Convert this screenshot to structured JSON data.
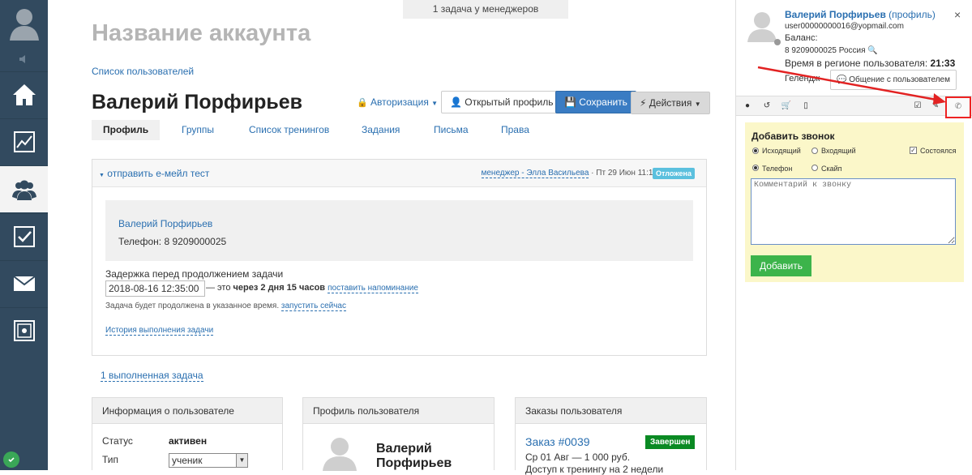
{
  "notice": "1 задача у менеджеров",
  "account_title": "Название аккаунта",
  "users_list_link": "Список пользователей",
  "user_name": "Валерий Порфирьев",
  "buttons": {
    "auth": "Авторизация",
    "open_profile": "Открытый профиль",
    "save": "Сохранить",
    "actions": "Действия"
  },
  "tabs": [
    "Профиль",
    "Группы",
    "Список тренингов",
    "Задания",
    "Письма",
    "Права"
  ],
  "task": {
    "title": "отправить е-мейл тест",
    "manager": "менеджер - Элла Васильева",
    "date": "· Пт 29 Июн 11:17",
    "status": "Отложена",
    "card_name": "Валерий Порфирьев",
    "card_phone": "Телефон: 8 9209000025",
    "delay_label": "Задержка перед продолжением задачи",
    "delay_value": "2018-08-16 12:35:00",
    "delay_prefix": "— это",
    "delay_bold": "через 2 дня 15 часов",
    "set_reminder": "поставить напоминание",
    "delay_note": "Задача будет продолжена в указанное время.",
    "run_now": "запустить сейчас",
    "history": "История выполнения задачи"
  },
  "completed_tasks": "1 выполненная задача",
  "info_card": {
    "title": "Информация о пользователе",
    "status_label": "Статус",
    "status_value": "активен",
    "type_label": "Тип",
    "type_value": "ученик"
  },
  "profile_card": {
    "title": "Профиль пользователя",
    "name_line1": "Валерий",
    "name_line2": "Порфирьев"
  },
  "orders_card": {
    "title": "Заказы пользователя",
    "order": "Заказ #0039",
    "order_status": "Завершен",
    "order_date": "Ср 01 Авг — 1 000 руб.",
    "order_access": "Доступ к тренингу на 2 недели"
  },
  "right_panel": {
    "name": "Валерий Порфирьев",
    "profile_link": "(профиль)",
    "email": "user00000000016@yopmail.com",
    "balance": "Баланс:",
    "phone": "8 9209000025 Россия",
    "time_label": "Время в регионе пользователя:",
    "time_value": "21:33",
    "gel": "Гелендж",
    "chat_button": "Общение с пользователем",
    "close": "×"
  },
  "call_form": {
    "title": "Добавить звонок",
    "outgoing": "Исходящий",
    "incoming": "Входящий",
    "took_place": "Состоялся",
    "phone": "Телефон",
    "skype": "Скайп",
    "comment_placeholder": "Комментарий к звонку",
    "add_button": "Добавить"
  },
  "colors": {
    "sidebar": "#324a5f",
    "save_button": "#3a7cc3",
    "add_button": "#3cb44b",
    "form_bg": "#fbf7c9",
    "annotation": "#e22222"
  }
}
